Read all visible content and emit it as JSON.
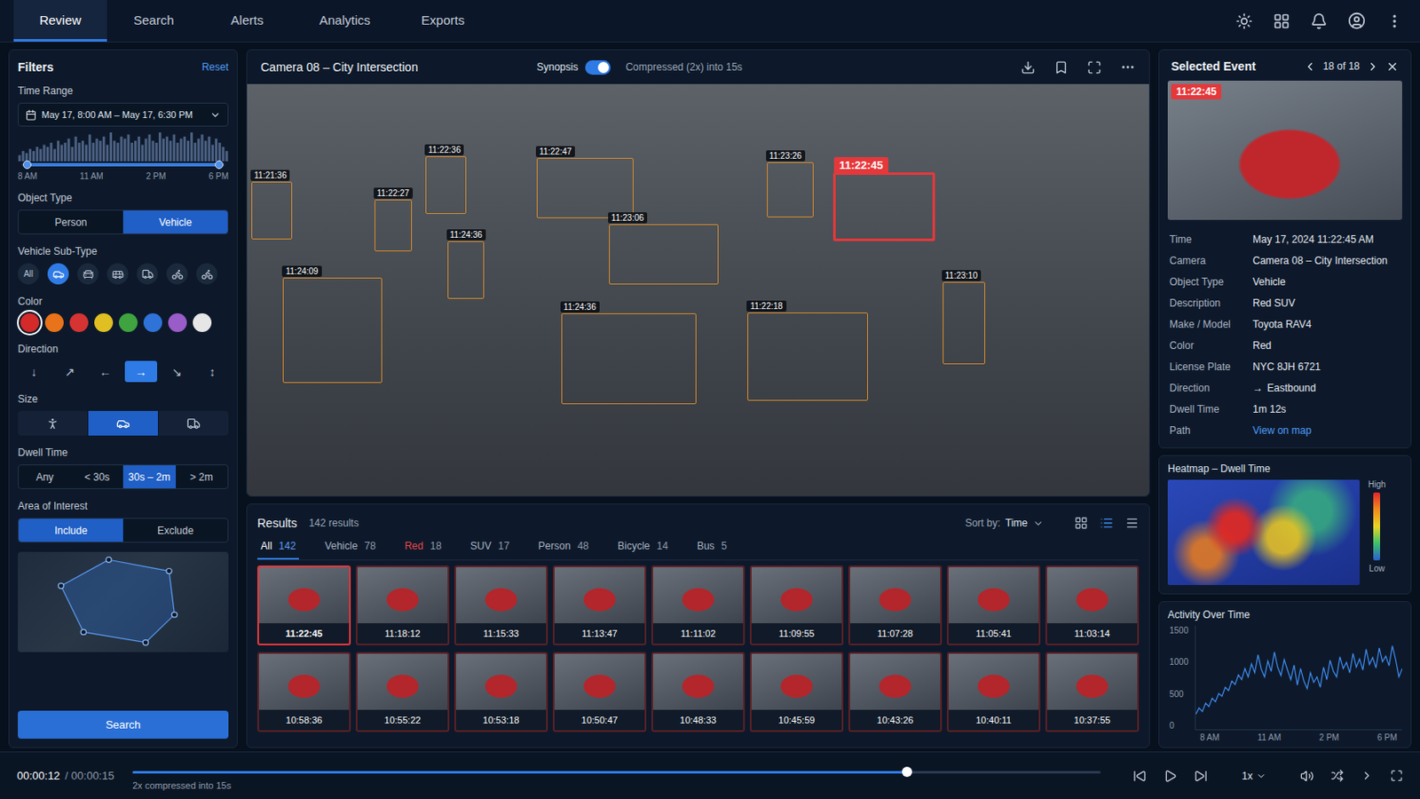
{
  "nav": {
    "tabs": [
      {
        "label": "Review",
        "selected": true
      },
      {
        "label": "Search",
        "selected": false
      },
      {
        "label": "Alerts",
        "selected": false
      },
      {
        "label": "Analytics",
        "selected": false
      },
      {
        "label": "Exports",
        "selected": false
      }
    ]
  },
  "filters": {
    "title": "Filters",
    "reset": "Reset",
    "time_range": {
      "label": "Time Range",
      "value": "May 17, 8:00 AM – May 17, 6:30 PM",
      "histogram": [
        3,
        5,
        4,
        6,
        5,
        7,
        6,
        8,
        7,
        9,
        6,
        10,
        8,
        9,
        11,
        7,
        12,
        9,
        10,
        8,
        13,
        9,
        11,
        10,
        12,
        8,
        14,
        10,
        9,
        12,
        11,
        13,
        9,
        10,
        12,
        8,
        11,
        13,
        10,
        9,
        14,
        11,
        12,
        10,
        13,
        9,
        11,
        12,
        10,
        14,
        9,
        11,
        13,
        10,
        12,
        8,
        11,
        9,
        7,
        5
      ],
      "level_start": 0.03,
      "level_end": 0.97,
      "ticks": [
        "8 AM",
        "11 AM",
        "2 PM",
        "6 PM"
      ]
    },
    "object_type": {
      "label": "Object Type",
      "options": [
        {
          "label": "Person",
          "selected": false
        },
        {
          "label": "Vehicle",
          "selected": true
        }
      ]
    },
    "vehicle_sub_type": {
      "label": "Vehicle Sub-Type",
      "options": [
        {
          "kind": "text",
          "label": "All",
          "selected": false
        },
        {
          "kind": "icon",
          "selected": true
        },
        {
          "kind": "icon",
          "selected": false
        },
        {
          "kind": "icon",
          "selected": false
        },
        {
          "kind": "icon",
          "selected": false
        },
        {
          "kind": "icon",
          "selected": false
        },
        {
          "kind": "icon",
          "selected": false
        }
      ]
    },
    "color": {
      "label": "Color",
      "swatches": [
        {
          "color": "#d42a2a",
          "selected": true
        },
        {
          "color": "#e8731a",
          "selected": false
        },
        {
          "color": "#d63333",
          "selected": false
        },
        {
          "color": "#e0bf22",
          "selected": false
        },
        {
          "color": "#3fa33f",
          "selected": false
        },
        {
          "color": "#2f73d8",
          "selected": false
        },
        {
          "color": "#9a5cc8",
          "selected": false
        },
        {
          "color": "#e6e6e6",
          "selected": false
        }
      ]
    },
    "direction": {
      "label": "Direction",
      "options": [
        {
          "label": "↓",
          "selected": false
        },
        {
          "label": "↗",
          "selected": false
        },
        {
          "label": "←",
          "selected": false
        },
        {
          "label": "→",
          "selected": true
        },
        {
          "label": "↘",
          "selected": false
        },
        {
          "label": "↕",
          "selected": false
        }
      ]
    },
    "size": {
      "label": "Size",
      "options": [
        {
          "selected": false
        },
        {
          "selected": true
        },
        {
          "selected": false
        }
      ]
    },
    "dwell_time": {
      "label": "Dwell Time",
      "options": [
        {
          "label": "Any",
          "selected": false
        },
        {
          "label": "< 30s",
          "selected": false
        },
        {
          "label": "30s – 2m",
          "selected": true
        },
        {
          "label": "> 2m",
          "selected": false
        }
      ]
    },
    "area_of_interest": {
      "label": "Area of Interest",
      "options": [
        {
          "label": "Include",
          "selected": true
        },
        {
          "label": "Exclude",
          "selected": false
        }
      ]
    },
    "search_button": "Search"
  },
  "video": {
    "title": "Camera 08 – City Intersection",
    "synopsis": {
      "label": "Synopsis",
      "on": true
    },
    "compression": "Compressed (2x) into 15s",
    "detections": [
      {
        "label": "11:21:36",
        "selected": false
      },
      {
        "label": "11:22:36",
        "selected": false
      },
      {
        "label": "11:22:47",
        "selected": false
      },
      {
        "label": "11:22:27",
        "selected": false
      },
      {
        "label": "11:23:06",
        "selected": false
      },
      {
        "label": "11:23:26",
        "selected": false
      },
      {
        "label": "11:22:45",
        "selected": true
      },
      {
        "label": "11:24:36",
        "selected": false
      },
      {
        "label": "11:24:09",
        "selected": false
      },
      {
        "label": "11:24:36",
        "selected": false
      },
      {
        "label": "11:22:18",
        "selected": false
      },
      {
        "label": "11:23:10",
        "selected": false
      }
    ]
  },
  "results": {
    "title": "Results",
    "count": "142 results",
    "sort": {
      "label": "Sort by:",
      "value": "Time"
    },
    "view_modes": [
      {
        "selected": false
      },
      {
        "selected": true
      },
      {
        "selected": false
      }
    ],
    "tabs": [
      {
        "label": "All",
        "count": "142",
        "selected": true,
        "color": "#aab4c3"
      },
      {
        "label": "Vehicle",
        "count": "78",
        "selected": false,
        "color": "#aab4c3"
      },
      {
        "label": "Red",
        "count": "18",
        "selected": false,
        "color": "#e5484d"
      },
      {
        "label": "SUV",
        "count": "17",
        "selected": false,
        "color": "#aab4c3"
      },
      {
        "label": "Person",
        "count": "48",
        "selected": false,
        "color": "#aab4c3"
      },
      {
        "label": "Bicycle",
        "count": "14",
        "selected": false,
        "color": "#aab4c3"
      },
      {
        "label": "Bus",
        "count": "5",
        "selected": false,
        "color": "#aab4c3"
      }
    ],
    "thumbnails": [
      {
        "time": "11:22:45",
        "selected": true
      },
      {
        "time": "11:18:12",
        "selected": false
      },
      {
        "time": "11:15:33",
        "selected": false
      },
      {
        "time": "11:13:47",
        "selected": false
      },
      {
        "time": "11:11:02",
        "selected": false
      },
      {
        "time": "11:09:55",
        "selected": false
      },
      {
        "time": "11:07:28",
        "selected": false
      },
      {
        "time": "11:05:41",
        "selected": false
      },
      {
        "time": "11:03:14",
        "selected": false
      },
      {
        "time": "10:58:36",
        "selected": false
      },
      {
        "time": "10:55:22",
        "selected": false
      },
      {
        "time": "10:53:18",
        "selected": false
      },
      {
        "time": "10:50:47",
        "selected": false
      },
      {
        "time": "10:48:33",
        "selected": false
      },
      {
        "time": "10:45:59",
        "selected": false
      },
      {
        "time": "10:43:26",
        "selected": false
      },
      {
        "time": "10:40:11",
        "selected": false
      },
      {
        "time": "10:37:55",
        "selected": false
      }
    ]
  },
  "selected_event": {
    "title": "Selected Event",
    "position": "18 of 18",
    "badge": "11:22:45",
    "details": [
      {
        "label": "Time",
        "value": "May 17, 2024 11:22:45 AM",
        "kind": "text"
      },
      {
        "label": "Camera",
        "value": "Camera 08 – City Intersection",
        "kind": "text"
      },
      {
        "label": "Object Type",
        "value": "Vehicle",
        "kind": "text"
      },
      {
        "label": "Description",
        "value": "Red SUV",
        "kind": "text"
      },
      {
        "label": "Make / Model",
        "value": "Toyota RAV4",
        "kind": "text"
      },
      {
        "label": "Color",
        "value": "Red",
        "kind": "text"
      },
      {
        "label": "License Plate",
        "value": "NYC 8JH 6721",
        "kind": "text"
      },
      {
        "label": "Direction",
        "icon": "→",
        "value": "Eastbound",
        "kind": "direction"
      },
      {
        "label": "Dwell Time",
        "value": "1m 12s",
        "kind": "text"
      },
      {
        "label": "Path",
        "value": "View on map",
        "kind": "link"
      }
    ]
  },
  "heatmap": {
    "title": "Heatmap – Dwell Time",
    "legend_high": "High",
    "legend_low": "Low"
  },
  "activity": {
    "title": "Activity Over Time",
    "y_ticks": [
      "1500",
      "1000",
      "500",
      "0"
    ],
    "x_ticks": [
      "8 AM",
      "11 AM",
      "2 PM",
      "6 PM"
    ],
    "series": [
      220,
      310,
      260,
      380,
      330,
      450,
      400,
      520,
      480,
      610,
      560,
      700,
      650,
      790,
      720,
      880,
      760,
      950,
      820,
      1080,
      870,
      760,
      990,
      840,
      1120,
      900,
      780,
      1010,
      860,
      720,
      930,
      640,
      880,
      700,
      590,
      820,
      680,
      760,
      610,
      900,
      720,
      1000,
      840,
      760,
      1050,
      880,
      970,
      820,
      1100,
      900,
      1020,
      860,
      1160,
      940,
      1040,
      890,
      1180,
      980,
      1060,
      920,
      1210,
      1010,
      760,
      880
    ]
  },
  "playback": {
    "current": "00:00:12",
    "total": "/ 00:00:15",
    "note": "2x compressed into 15s",
    "level": 0.8,
    "speed": "1x"
  }
}
